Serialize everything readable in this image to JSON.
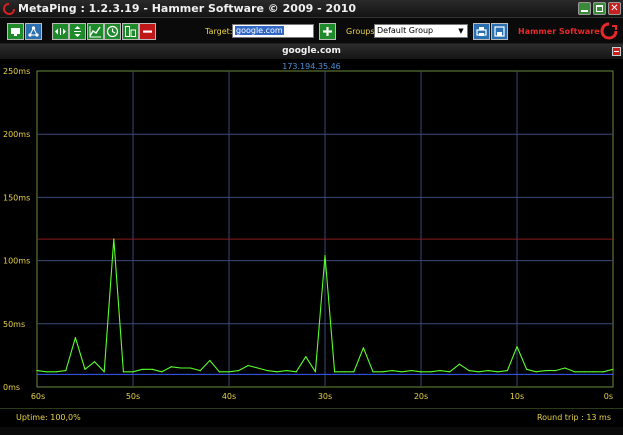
{
  "window": {
    "title": "MetaPing : 1.2.3.19 - Hammer Software © 2009 - 2010"
  },
  "toolbar": {
    "buttons": [
      {
        "name": "monitor-button",
        "icon": "monitor-icon"
      },
      {
        "name": "network-button",
        "icon": "network-icon"
      },
      {
        "name": "expand-horizontal-button",
        "icon": "arrows-horizontal-icon"
      },
      {
        "name": "expand-vertical-button",
        "icon": "arrows-vertical-icon"
      },
      {
        "name": "graph-button",
        "icon": "graph-icon"
      },
      {
        "name": "clock-button",
        "icon": "clock-icon"
      },
      {
        "name": "tile-button",
        "icon": "tile-icon"
      },
      {
        "name": "stop-button",
        "icon": "minus-icon"
      }
    ],
    "target_label": "Target:",
    "target_value": "google.com",
    "groups_label": "Groups",
    "groups_value": "Default Group",
    "brand": "Hammer Software"
  },
  "host": {
    "name": "google.com",
    "ip": "173.194.35.46"
  },
  "colors": {
    "ping_line": "#5aff2a",
    "baseline_line": "#3a5cff",
    "threshold_line": "#8a1a1a",
    "grid": "#3a4a7a",
    "frame_border": "#6a8a3a",
    "label_text": "#e8d24a"
  },
  "chart_data": {
    "type": "line",
    "title": "",
    "xlabel": "",
    "ylabel": "",
    "x_ticks": [
      "60s",
      "50s",
      "40s",
      "30s",
      "20s",
      "10s",
      "0s"
    ],
    "y_ticks": [
      "0ms",
      "50ms",
      "100ms",
      "150ms",
      "200ms",
      "250ms"
    ],
    "xlim": [
      60,
      0
    ],
    "ylim": [
      0,
      250
    ],
    "grid": true,
    "series": [
      {
        "values_x": [
          60,
          59,
          58,
          57,
          56,
          55,
          54,
          53,
          52,
          51,
          50,
          49,
          48,
          47,
          46,
          45,
          44,
          43,
          42,
          41,
          40,
          39,
          38,
          37,
          36,
          35,
          34,
          33,
          32,
          31,
          30,
          29,
          28,
          27,
          26,
          25,
          24,
          23,
          22,
          21,
          20,
          19,
          18,
          17,
          16,
          15,
          14,
          13,
          12,
          11,
          10,
          9,
          8,
          7,
          6,
          5,
          4,
          3,
          2,
          1,
          0
        ],
        "values_y": [
          13,
          12,
          12,
          13,
          39,
          14,
          20,
          12,
          117,
          12,
          12,
          14,
          14,
          12,
          16,
          15,
          15,
          13,
          21,
          12,
          12,
          13,
          17,
          15,
          13,
          12,
          13,
          12,
          24,
          12,
          104,
          12,
          12,
          12,
          31,
          12,
          12,
          13,
          12,
          13,
          12,
          12,
          13,
          12,
          18,
          13,
          12,
          13,
          12,
          13,
          32,
          14,
          12,
          13,
          13,
          15,
          12,
          12,
          12,
          12,
          14
        ]
      }
    ],
    "reference_lines": [
      {
        "y": 117
      },
      {
        "y": 10
      }
    ]
  },
  "status": {
    "uptime": "Uptime: 100,0%",
    "roundtrip": "Round trip : 13 ms"
  }
}
